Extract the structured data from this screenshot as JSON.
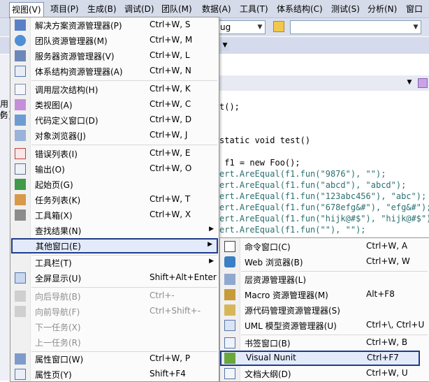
{
  "menubar": [
    "视图(V)",
    "项目(P)",
    "生成(B)",
    "调试(D)",
    "团队(M)",
    "数据(A)",
    "工具(T)",
    "体系结构(C)",
    "测试(S)",
    "分析(N)",
    "窗口"
  ],
  "toolbar": {
    "config_value": "ug"
  },
  "code_lines": [
    "t();",
    "",
    "",
    "static void test()",
    "",
    " f1 = new Foo();",
    "ert.AreEqual(f1.fun(\"9876\"), \"\");",
    "ert.AreEqual(f1.fun(\"abcd\"), \"abcd\");",
    "ert.AreEqual(f1.fun(\"123abc456\"), \"abc\");",
    "ert.AreEqual(f1.fun(\"678efg&#\"), \"efg&#\");",
    "ert.AreEqual(f1.fun(\"hijk@#$\"), \"hijk@#$\");",
    "ert.AreEqual(f1.fun(\"\"), \"\");"
  ],
  "left_fragments": [
    "用(",
    "务]"
  ],
  "view_menu": [
    {
      "label": "解决方案资源管理器(P)",
      "shortcut": "Ctrl+W, S",
      "icon": "solution-explorer-icon"
    },
    {
      "label": "团队资源管理器(M)",
      "shortcut": "Ctrl+W, M",
      "icon": "team-explorer-icon"
    },
    {
      "label": "服务器资源管理器(V)",
      "shortcut": "Ctrl+W, L",
      "icon": "server-explorer-icon"
    },
    {
      "label": "体系结构资源管理器(A)",
      "shortcut": "Ctrl+W, N",
      "icon": "architecture-explorer-icon"
    },
    {
      "label": "调用层次结构(H)",
      "shortcut": "Ctrl+W, K",
      "icon": "call-hierarchy-icon"
    },
    {
      "label": "类视图(A)",
      "shortcut": "Ctrl+W, C",
      "icon": "class-view-icon"
    },
    {
      "label": "代码定义窗口(D)",
      "shortcut": "Ctrl+W, D",
      "icon": "code-definition-icon"
    },
    {
      "label": "对象浏览器(J)",
      "shortcut": "Ctrl+W, J",
      "icon": "object-browser-icon"
    },
    {
      "label": "错误列表(I)",
      "shortcut": "Ctrl+W, E",
      "icon": "error-list-icon"
    },
    {
      "label": "输出(O)",
      "shortcut": "Ctrl+W, O",
      "icon": "output-icon"
    },
    {
      "label": "起始页(G)",
      "shortcut": "",
      "icon": "start-page-icon"
    },
    {
      "label": "任务列表(K)",
      "shortcut": "Ctrl+W, T",
      "icon": "task-list-icon"
    },
    {
      "label": "工具箱(X)",
      "shortcut": "Ctrl+W, X",
      "icon": "toolbox-icon"
    },
    {
      "label": "查找结果(N)",
      "shortcut": "",
      "icon": ""
    },
    {
      "label": "其他窗口(E)",
      "shortcut": "",
      "icon": ""
    },
    {
      "label": "工具栏(T)",
      "shortcut": "",
      "icon": ""
    },
    {
      "label": "全屏显示(U)",
      "shortcut": "Shift+Alt+Enter",
      "icon": "full-screen-icon"
    },
    {
      "label": "向后导航(B)",
      "shortcut": "Ctrl+-",
      "icon": "navigate-back-icon"
    },
    {
      "label": "向前导航(F)",
      "shortcut": "Ctrl+Shift+-",
      "icon": "navigate-forward-icon"
    },
    {
      "label": "下一任务(X)",
      "shortcut": "",
      "icon": ""
    },
    {
      "label": "上一任务(R)",
      "shortcut": "",
      "icon": ""
    },
    {
      "label": "属性窗口(W)",
      "shortcut": "Ctrl+W, P",
      "icon": "properties-window-icon"
    },
    {
      "label": "属性页(Y)",
      "shortcut": "Shift+F4",
      "icon": "property-pages-icon"
    }
  ],
  "other_windows_menu": [
    {
      "label": "命令窗口(C)",
      "shortcut": "Ctrl+W, A",
      "icon": "command-window-icon"
    },
    {
      "label": "Web 浏览器(B)",
      "shortcut": "Ctrl+W, W",
      "icon": "web-browser-icon"
    },
    {
      "label": "层资源管理器(L)",
      "shortcut": "",
      "icon": "layer-explorer-icon"
    },
    {
      "label": "Macro 资源管理器(M)",
      "shortcut": "Alt+F8",
      "icon": "macro-explorer-icon"
    },
    {
      "label": "源代码管理资源管理器(S)",
      "shortcut": "",
      "icon": "source-control-icon"
    },
    {
      "label": "UML 模型资源管理器(U)",
      "shortcut": "Ctrl+\\, Ctrl+U",
      "icon": "uml-explorer-icon"
    },
    {
      "label": "书签窗口(B)",
      "shortcut": "Ctrl+W, B",
      "icon": "bookmark-window-icon"
    },
    {
      "label": "Visual Nunit",
      "shortcut": "Ctrl+F7",
      "icon": "visual-nunit-icon"
    },
    {
      "label": "文档大纲(D)",
      "shortcut": "Ctrl+W, U",
      "icon": "document-outline-icon"
    }
  ]
}
